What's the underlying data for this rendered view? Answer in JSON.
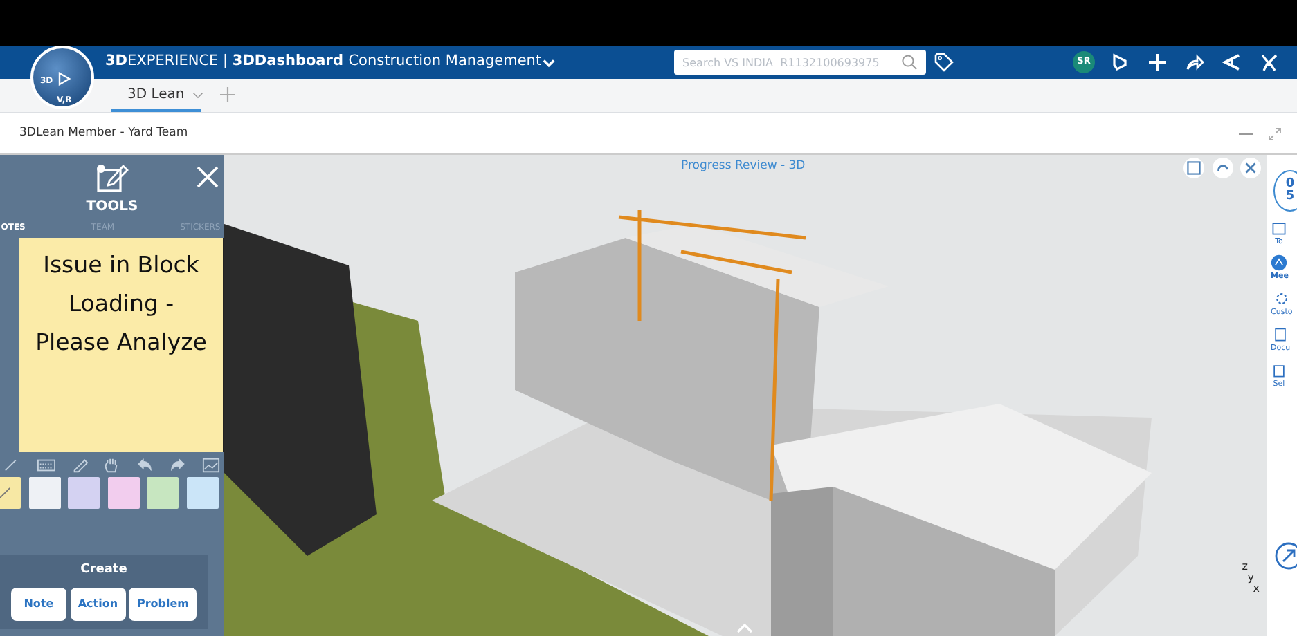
{
  "header": {
    "compass_labels": [
      "3D",
      "V,R"
    ],
    "brand_bold": "3D",
    "brand_rest": "EXPERIENCE",
    "separator": "|",
    "app": "3DDashboard",
    "dashboard": "Construction Management",
    "search": {
      "placeholder": "Search VS INDIA  R1132100693975"
    },
    "avatar": "SR"
  },
  "tabs": [
    {
      "label": "3D Lean",
      "selected": true
    }
  ],
  "widget": {
    "title": "3DLean Member - Yard Team"
  },
  "tools": {
    "title": "TOOLS",
    "tabs": [
      {
        "label": "OTES",
        "selected": true
      },
      {
        "label": "TEAM",
        "selected": false
      },
      {
        "label": "STICKERS",
        "selected": false
      }
    ],
    "note": [
      "Issue in Block",
      "Loading -",
      "Please Analyze"
    ],
    "swatches": [
      {
        "color": "#f7e8a4",
        "selected": true
      },
      {
        "color": "#eef1f5",
        "selected": false
      },
      {
        "color": "#d4d2f2",
        "selected": false
      },
      {
        "color": "#f2cdee",
        "selected": false
      },
      {
        "color": "#c7e6c0",
        "selected": false
      },
      {
        "color": "#cbe5f8",
        "selected": false
      }
    ],
    "create": {
      "title": "Create",
      "buttons": [
        "Note",
        "Action",
        "Problem"
      ]
    }
  },
  "viewport": {
    "title": "Progress Review - 3D",
    "axes": [
      "z",
      "y",
      "x"
    ]
  },
  "rail": {
    "counter": [
      "0",
      "5"
    ],
    "items": [
      {
        "label": "To",
        "selected": false
      },
      {
        "label": "Mee",
        "selected": true
      },
      {
        "label": "Custo",
        "selected": false
      },
      {
        "label": "Docu",
        "selected": false
      },
      {
        "label": "Sel",
        "selected": false
      }
    ]
  }
}
